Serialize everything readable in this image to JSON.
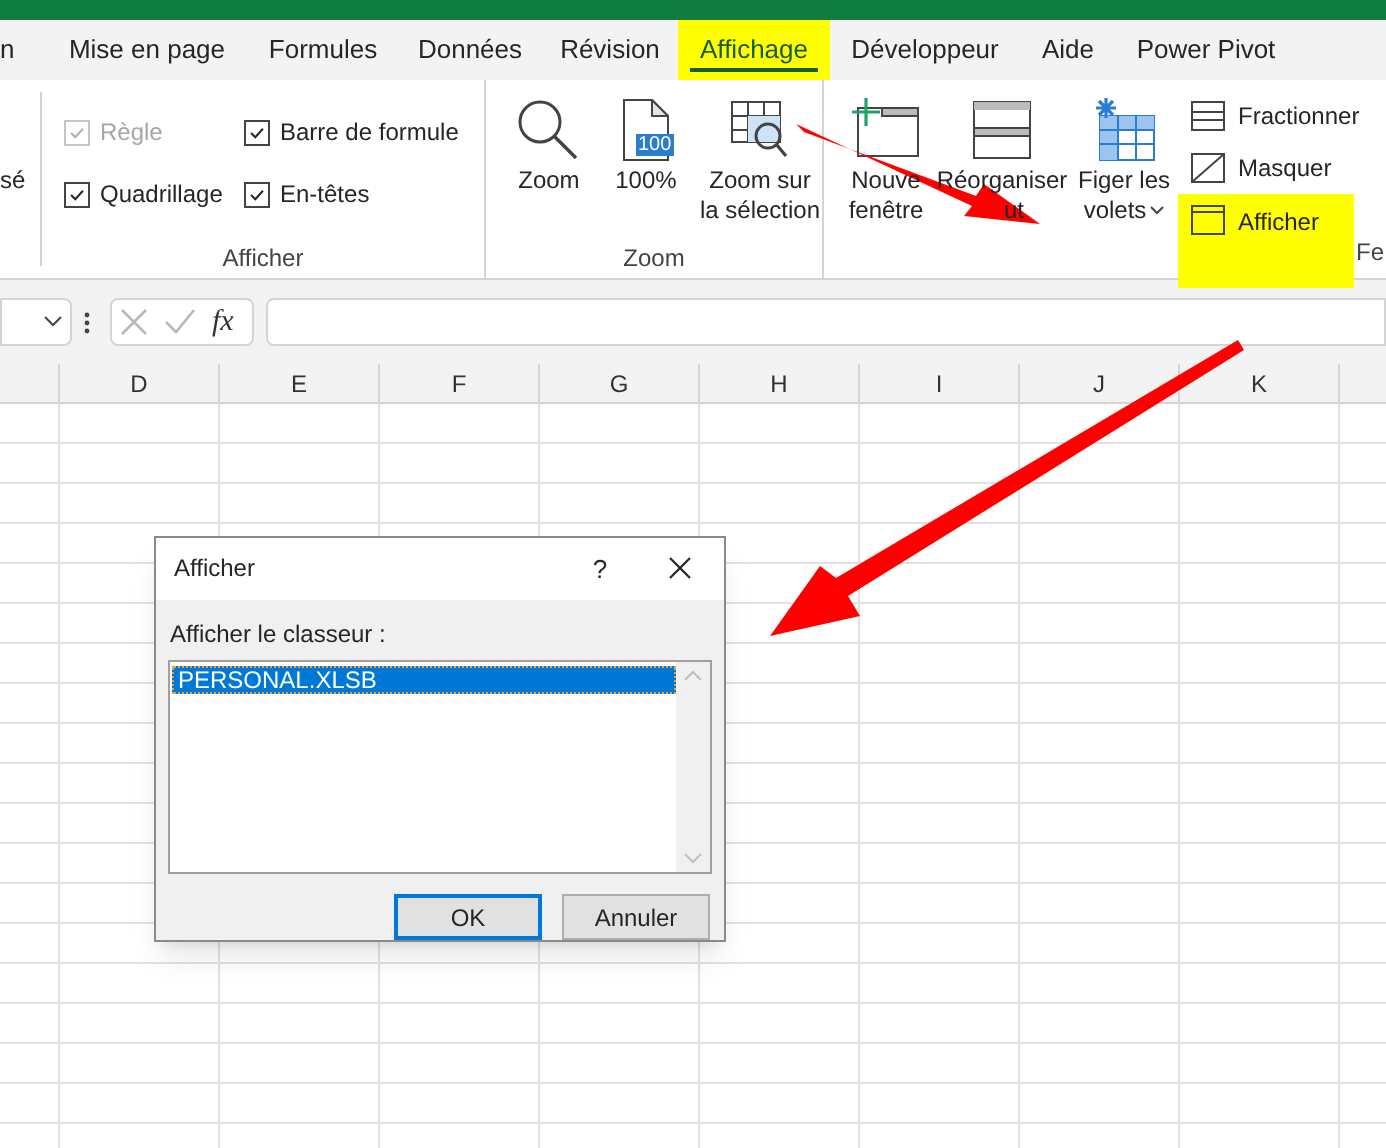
{
  "tabs": [
    {
      "label": "n",
      "selected": false,
      "highlighted": false
    },
    {
      "label": "Mise en page",
      "selected": false,
      "highlighted": false
    },
    {
      "label": "Formules",
      "selected": false,
      "highlighted": false
    },
    {
      "label": "Données",
      "selected": false,
      "highlighted": false
    },
    {
      "label": "Révision",
      "selected": false,
      "highlighted": false
    },
    {
      "label": "Affichage",
      "selected": true,
      "highlighted": true
    },
    {
      "label": "Développeur",
      "selected": false,
      "highlighted": false
    },
    {
      "label": "Aide",
      "selected": false,
      "highlighted": false
    },
    {
      "label": "Power Pivot",
      "selected": false,
      "highlighted": false
    }
  ],
  "ribbon": {
    "partial_label": "sé",
    "groups": [
      {
        "label": "Afficher",
        "commands": [
          {
            "kind": "checkbox",
            "label": "Règle",
            "checked": true,
            "disabled": true
          },
          {
            "kind": "checkbox",
            "label": "Barre de formule",
            "checked": true,
            "disabled": false
          },
          {
            "kind": "checkbox",
            "label": "Quadrillage",
            "checked": true,
            "disabled": false
          },
          {
            "kind": "checkbox",
            "label": "En-têtes",
            "checked": true,
            "disabled": false
          }
        ]
      },
      {
        "label": "Zoom",
        "commands": [
          {
            "kind": "large",
            "lines": [
              "Zoom"
            ]
          },
          {
            "kind": "large",
            "lines": [
              "100%"
            ],
            "icon_text": "100"
          },
          {
            "kind": "large",
            "lines": [
              "Zoom sur",
              "la sélection"
            ]
          }
        ]
      },
      {
        "label": "Fe",
        "commands": [
          {
            "kind": "large",
            "lines": [
              "Nouve",
              "fenêtre"
            ]
          },
          {
            "kind": "large",
            "lines": [
              "Réorganiser",
              "ut"
            ]
          },
          {
            "kind": "large",
            "lines": [
              "Figer les",
              "volets"
            ],
            "dropdown": true
          },
          {
            "kind": "small",
            "label": "Fractionner",
            "highlighted": false
          },
          {
            "kind": "small",
            "label": "Masquer",
            "highlighted": false
          },
          {
            "kind": "small",
            "label": "Afficher",
            "highlighted": true
          }
        ]
      }
    ]
  },
  "formula_bar": {
    "fx": "fx"
  },
  "columns": [
    "D",
    "E",
    "F",
    "G",
    "H",
    "I",
    "J",
    "K"
  ],
  "dialog": {
    "title": "Afficher",
    "help": "?",
    "label": "Afficher le classeur :",
    "items": [
      {
        "text": "PERSONAL.XLSB",
        "selected": true
      }
    ],
    "buttons": [
      {
        "label": "OK",
        "default": true
      },
      {
        "label": "Annuler",
        "default": false
      }
    ]
  }
}
